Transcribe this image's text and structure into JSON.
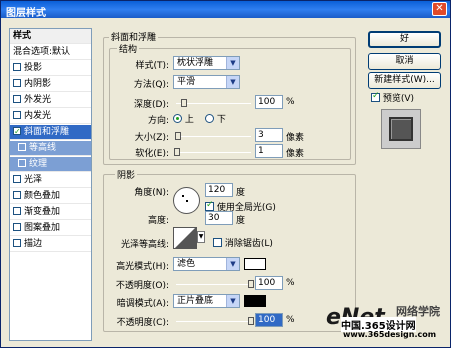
{
  "window": {
    "title": "图层样式",
    "close_glyph": "✕"
  },
  "sidebar": {
    "header": "样式",
    "blend_options": "混合选项:默认",
    "items": [
      {
        "label": "投影",
        "checked": false
      },
      {
        "label": "内阴影",
        "checked": false
      },
      {
        "label": "外发光",
        "checked": false
      },
      {
        "label": "内发光",
        "checked": false
      },
      {
        "label": "斜面和浮雕",
        "checked": true,
        "selected": true
      },
      {
        "label": "等高线",
        "checked": false,
        "sub": true
      },
      {
        "label": "纹理",
        "checked": false,
        "sub": true
      },
      {
        "label": "光泽",
        "checked": false
      },
      {
        "label": "颜色叠加",
        "checked": false
      },
      {
        "label": "渐变叠加",
        "checked": false
      },
      {
        "label": "图案叠加",
        "checked": false
      },
      {
        "label": "描边",
        "checked": false
      }
    ]
  },
  "bevel": {
    "group_title": "斜面和浮雕",
    "structure_title": "结构",
    "style_label": "样式(T):",
    "style_value": "枕状浮雕",
    "technique_label": "方法(Q):",
    "technique_value": "平滑",
    "depth_label": "深度(D):",
    "depth_value": "100",
    "depth_unit": "%",
    "depth_fraction": 0.1,
    "direction_label": "方向:",
    "dir_up": "上",
    "dir_down": "下",
    "direction_value": "上",
    "size_label": "大小(Z):",
    "size_value": "3",
    "size_unit": "像素",
    "size_fraction": 0.02,
    "soften_label": "软化(E):",
    "soften_value": "1",
    "soften_unit": "像素",
    "soften_fraction": 0.01
  },
  "shading": {
    "title": "阴影",
    "angle_label": "角度(N):",
    "angle_value": "120",
    "angle_unit": "度",
    "global_light_label": "使用全局光(G)",
    "global_light": true,
    "altitude_label": "高度:",
    "altitude_value": "30",
    "altitude_unit": "度",
    "gloss_label": "光泽等高线:",
    "antialias_label": "消除锯齿(L)",
    "antialias": false,
    "highlight_mode_label": "高光模式(H):",
    "highlight_mode": "滤色",
    "highlight_color": "#ffffff",
    "highlight_opacity_label": "不透明度(O):",
    "highlight_opacity": "100",
    "highlight_opacity_unit": "%",
    "highlight_opacity_fraction": 1.0,
    "shadow_mode_label": "暗调模式(A):",
    "shadow_mode": "正片叠底",
    "shadow_color": "#000000",
    "shadow_opacity_label": "不透明度(C):",
    "shadow_opacity": "100",
    "shadow_opacity_unit": "%",
    "shadow_opacity_fraction": 1.0
  },
  "buttons": {
    "ok": "好",
    "cancel": "取消",
    "new_style": "新建样式(W)...",
    "preview": "预览(V)",
    "preview_checked": true
  },
  "watermark": {
    "brand": "eNet",
    "site": "中国.365设计网",
    "url": "www.365design.com",
    "suffix": "网络学院"
  }
}
